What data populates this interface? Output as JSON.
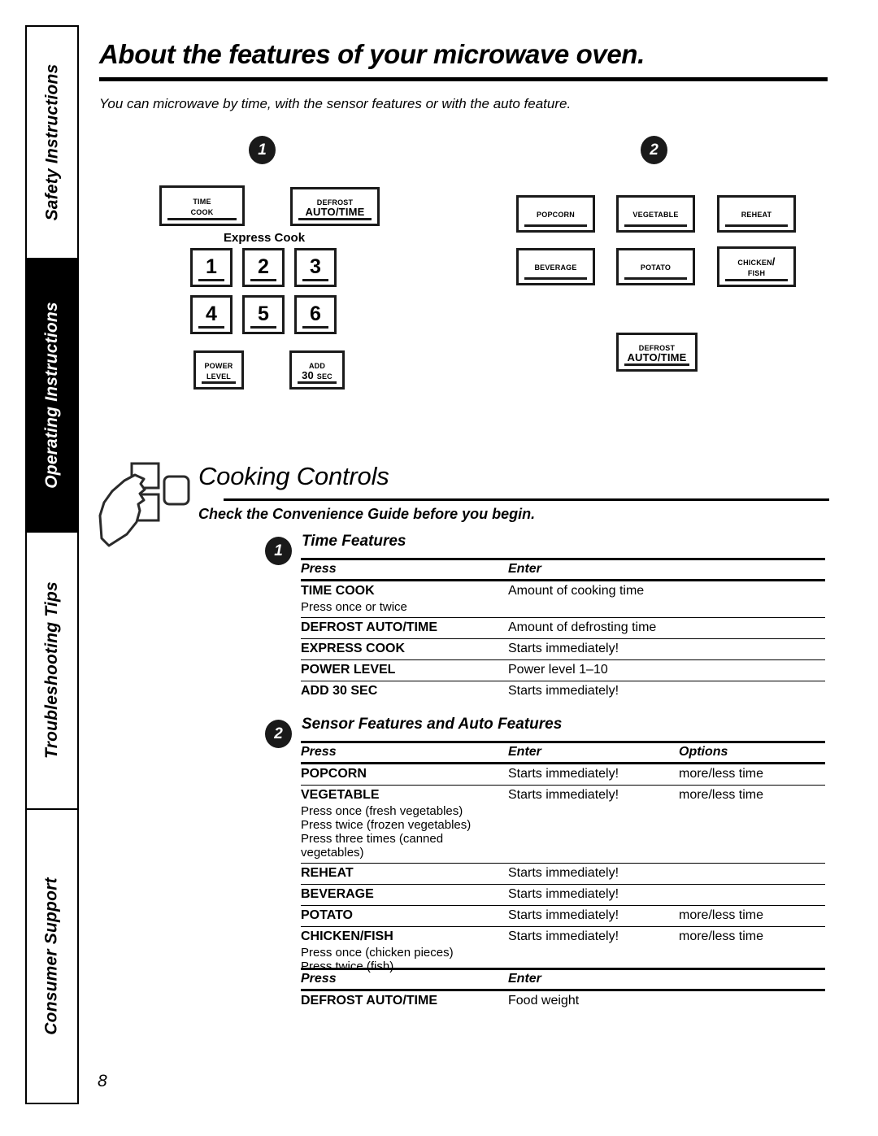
{
  "sidebar": {
    "tabs": [
      {
        "label": "Safety Instructions",
        "active": false
      },
      {
        "label": "Operating Instructions",
        "active": true
      },
      {
        "label": "Troubleshooting Tips",
        "active": false
      },
      {
        "label": "Consumer Support",
        "active": false
      }
    ]
  },
  "header": {
    "title": "About the features of your microwave oven.",
    "intro": "You can microwave by time, with the sensor features or with the auto feature."
  },
  "badges": {
    "panel_one": "1",
    "panel_two": "2",
    "section_one": "1",
    "section_two": "2"
  },
  "keypad_left": {
    "express_label": "Express Cook",
    "keys": [
      {
        "lines": [
          "Time",
          "Cook"
        ],
        "style": "smallcaps"
      },
      {
        "lines": [
          "Defrost",
          "AUTO/TIME"
        ],
        "style": "mixed"
      },
      {
        "lines": [
          "1"
        ],
        "style": "num"
      },
      {
        "lines": [
          "2"
        ],
        "style": "num"
      },
      {
        "lines": [
          "3"
        ],
        "style": "num"
      },
      {
        "lines": [
          "4"
        ],
        "style": "num"
      },
      {
        "lines": [
          "5"
        ],
        "style": "num"
      },
      {
        "lines": [
          "6"
        ],
        "style": "num"
      },
      {
        "lines": [
          "Power",
          "Level"
        ],
        "style": "smallcaps"
      },
      {
        "lines": [
          "Add",
          "30 Sec"
        ],
        "style": "smallcaps"
      }
    ]
  },
  "keypad_right": {
    "keys": [
      {
        "lines": [
          "Popcorn"
        ],
        "style": "smallcaps"
      },
      {
        "lines": [
          "Vegetable"
        ],
        "style": "smallcaps"
      },
      {
        "lines": [
          "Reheat"
        ],
        "style": "smallcaps"
      },
      {
        "lines": [
          "Beverage"
        ],
        "style": "smallcaps"
      },
      {
        "lines": [
          "Potato"
        ],
        "style": "smallcaps"
      },
      {
        "lines": [
          "Chicken/",
          "Fish"
        ],
        "style": "smallcaps"
      },
      {
        "lines": [
          "Defrost",
          "AUTO/TIME"
        ],
        "style": "mixed"
      }
    ]
  },
  "cooking_controls": {
    "title": "Cooking Controls",
    "subtitle": "Check the Convenience Guide before you begin."
  },
  "section1": {
    "title": "Time Features",
    "headers": {
      "press": "Press",
      "enter": "Enter"
    },
    "rows": [
      {
        "press": "TIME COOK",
        "note": "Press once or twice",
        "enter": "Amount of cooking time"
      },
      {
        "press": "DEFROST AUTO/TIME",
        "note": "",
        "enter": "Amount of defrosting time"
      },
      {
        "press": "EXPRESS COOK",
        "note": "",
        "enter": "Starts immediately!"
      },
      {
        "press": "POWER LEVEL",
        "note": "",
        "enter": "Power level 1–10"
      },
      {
        "press": "ADD 30 SEC",
        "note": "",
        "enter": "Starts immediately!"
      }
    ]
  },
  "section2": {
    "title": "Sensor Features and Auto Features",
    "headers": {
      "press": "Press",
      "enter": "Enter",
      "options": "Options"
    },
    "rows": [
      {
        "press": "POPCORN",
        "note": "",
        "enter": "Starts immediately!",
        "options": "more/less time"
      },
      {
        "press": "VEGETABLE",
        "note": "Press once (fresh vegetables)\nPress twice (frozen vegetables)\nPress three times (canned vegetables)",
        "enter": "Starts immediately!",
        "options": "more/less time"
      },
      {
        "press": "REHEAT",
        "note": "",
        "enter": "Starts immediately!",
        "options": ""
      },
      {
        "press": "BEVERAGE",
        "note": "",
        "enter": "Starts immediately!",
        "options": ""
      },
      {
        "press": "POTATO",
        "note": "",
        "enter": "Starts immediately!",
        "options": "more/less time"
      },
      {
        "press": "CHICKEN/FISH",
        "note": "Press once (chicken pieces)\nPress twice (fish)",
        "enter": "Starts immediately!",
        "options": "more/less time"
      }
    ]
  },
  "section3": {
    "headers": {
      "press": "Press",
      "enter": "Enter"
    },
    "rows": [
      {
        "press": "DEFROST AUTO/TIME",
        "enter": "Food weight"
      }
    ]
  },
  "footer": {
    "page_number": "8"
  }
}
